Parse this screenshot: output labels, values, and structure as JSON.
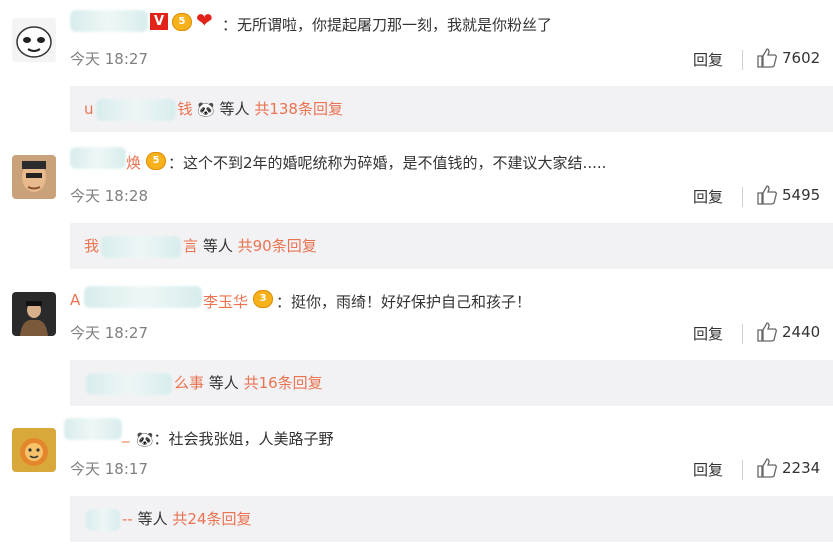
{
  "comments": [
    {
      "name_visible": "",
      "badges": [
        "V",
        "5",
        "heart"
      ],
      "text": "无所谓啦，你提起屠刀那一刻，我就是你粉丝了",
      "time": "今天 18:27",
      "reply_label": "回复",
      "likes": "7602",
      "replies": {
        "who_prefix": "u",
        "who_suffix": "钱",
        "emoji": "🐼",
        "etc": "等人",
        "count": "共138条回复"
      }
    },
    {
      "name_visible": "焕",
      "badges": [
        "5"
      ],
      "text": "这个不到2年的婚呢统称为碎婚，是不值钱的，不建议大家结.....",
      "time": "今天 18:28",
      "reply_label": "回复",
      "likes": "5495",
      "replies": {
        "who_prefix": "我",
        "who_suffix": "言",
        "emoji": "",
        "etc": "等人",
        "count": "共90条回复"
      }
    },
    {
      "name_visible": "李玉华",
      "name_prefix": "A",
      "badges": [
        "3"
      ],
      "text": "挺你，雨绮！好好保护自己和孩子！",
      "time": "今天 18:27",
      "reply_label": "回复",
      "likes": "2440",
      "replies": {
        "who_prefix": "",
        "who_suffix": "么事",
        "emoji": "",
        "etc": "等人",
        "count": "共16条回复"
      }
    },
    {
      "name_visible": "_",
      "badges": [
        "panda"
      ],
      "text": "社会我张姐，人美路子野",
      "time": "今天 18:17",
      "reply_label": "回复",
      "likes": "2234",
      "replies": {
        "who_prefix": "",
        "who_suffix": "--",
        "emoji": "",
        "etc": "等人",
        "count": "共24条回复"
      }
    }
  ],
  "colors": {
    "accent": "#eb7350",
    "muted": "#808080",
    "reply_bg": "#f2f2f5"
  }
}
